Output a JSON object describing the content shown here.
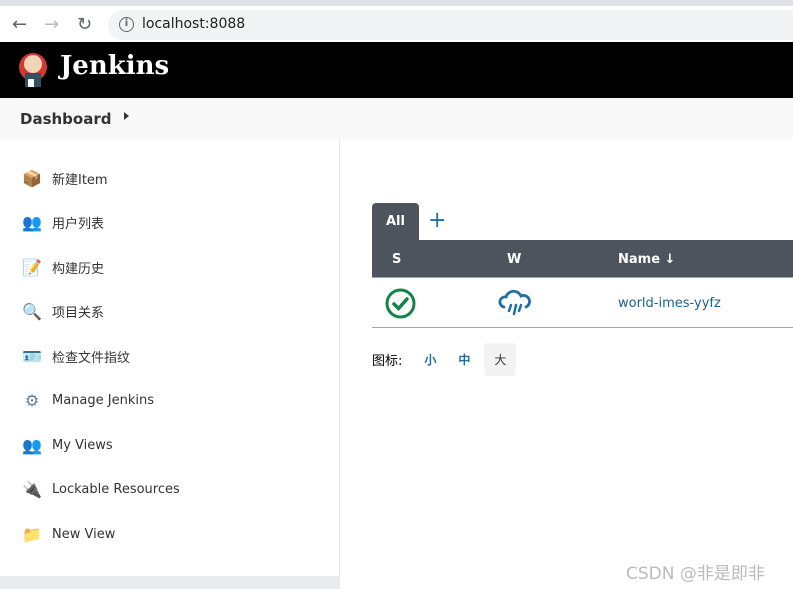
{
  "browser": {
    "url": "localhost:8088"
  },
  "header": {
    "brand": "Jenkins"
  },
  "breadcrumb": {
    "dashboard": "Dashboard"
  },
  "sidebar": {
    "items": [
      {
        "label": "新建Item",
        "icon": "new-item-icon"
      },
      {
        "label": "用户列表",
        "icon": "users-icon"
      },
      {
        "label": "构建历史",
        "icon": "notepad-icon"
      },
      {
        "label": "项目关系",
        "icon": "search-icon"
      },
      {
        "label": "检查文件指纹",
        "icon": "fingerprint-icon"
      },
      {
        "label": "Manage Jenkins",
        "icon": "gear-icon"
      },
      {
        "label": "My Views",
        "icon": "users-icon"
      },
      {
        "label": "Lockable Resources",
        "icon": "usb-icon"
      },
      {
        "label": "New View",
        "icon": "folder-icon"
      }
    ]
  },
  "main": {
    "tabs": [
      {
        "label": "All"
      }
    ],
    "add_tab": "+",
    "columns": {
      "s": "S",
      "w": "W",
      "name": "Name ↓"
    },
    "jobs": [
      {
        "name": "world-imes-yyfz",
        "status": "success",
        "weather": "rain"
      }
    ],
    "icon_legend": {
      "label": "图标:",
      "small": "小",
      "medium": "中",
      "large": "大",
      "selected": "large"
    }
  },
  "watermark": "CSDN @非是即非",
  "colors": {
    "success": "#138347",
    "link": "#1d6fa5",
    "header_bg": "#4d545d"
  }
}
